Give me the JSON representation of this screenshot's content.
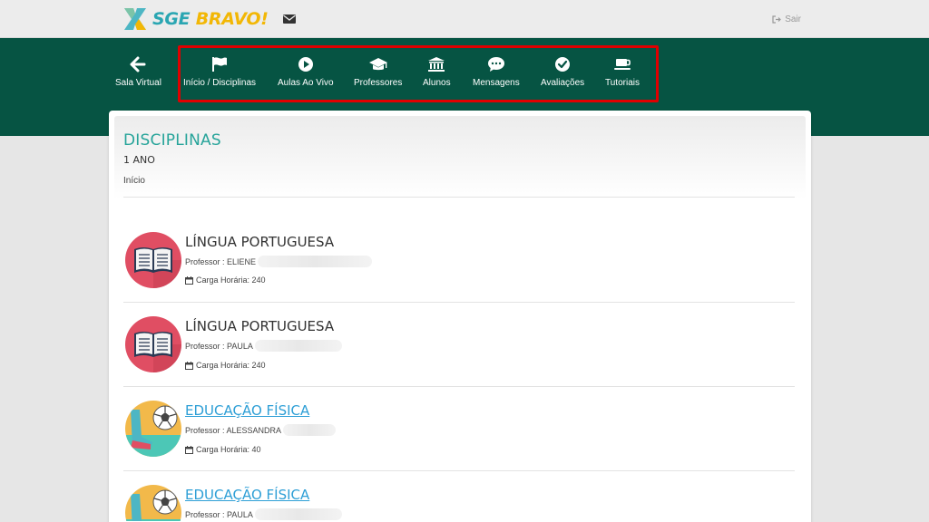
{
  "header": {
    "logo_text": "SGE",
    "logo_text_accent": "BRAVO!",
    "logout_label": "Sair"
  },
  "nav": {
    "items": [
      {
        "label": "Sala Virtual",
        "icon": "arrow-left-icon"
      },
      {
        "label": "Início / Disciplinas",
        "icon": "flag-icon"
      },
      {
        "label": "Aulas Ao Vivo",
        "icon": "play-circle-icon"
      },
      {
        "label": "Professores",
        "icon": "graduation-cap-icon"
      },
      {
        "label": "Alunos",
        "icon": "institution-icon"
      },
      {
        "label": "Mensagens",
        "icon": "chat-bubble-icon"
      },
      {
        "label": "Avaliações",
        "icon": "check-circle-icon"
      },
      {
        "label": "Tutoriais",
        "icon": "coffee-cup-icon"
      }
    ],
    "highlight_color": "#e00000"
  },
  "page": {
    "title": "DISCIPLINAS",
    "subtitle": "1 ANO",
    "breadcrumb": "Início"
  },
  "subjects": [
    {
      "name": "LÍNGUA PORTUGUESA",
      "professor_label": "Professor : ELIENE",
      "hours_label": "Carga Horária: 240",
      "icon": "book-icon"
    },
    {
      "name": "LÍNGUA PORTUGUESA",
      "professor_label": "Professor : PAULA",
      "hours_label": "Carga Horária: 240",
      "icon": "book-icon"
    },
    {
      "name": "EDUCAÇÃO FÍSICA",
      "professor_label": "Professor : ALESSANDRA",
      "hours_label": "Carga Horária: 40",
      "icon": "soccer-ball-icon"
    },
    {
      "name": "EDUCAÇÃO FÍSICA",
      "professor_label": "Professor : PAULA",
      "hours_label": "",
      "icon": "soccer-ball-icon"
    }
  ],
  "colors": {
    "nav_background": "#065443",
    "title_accent": "#27a49a",
    "link": "#2e9fd6"
  }
}
